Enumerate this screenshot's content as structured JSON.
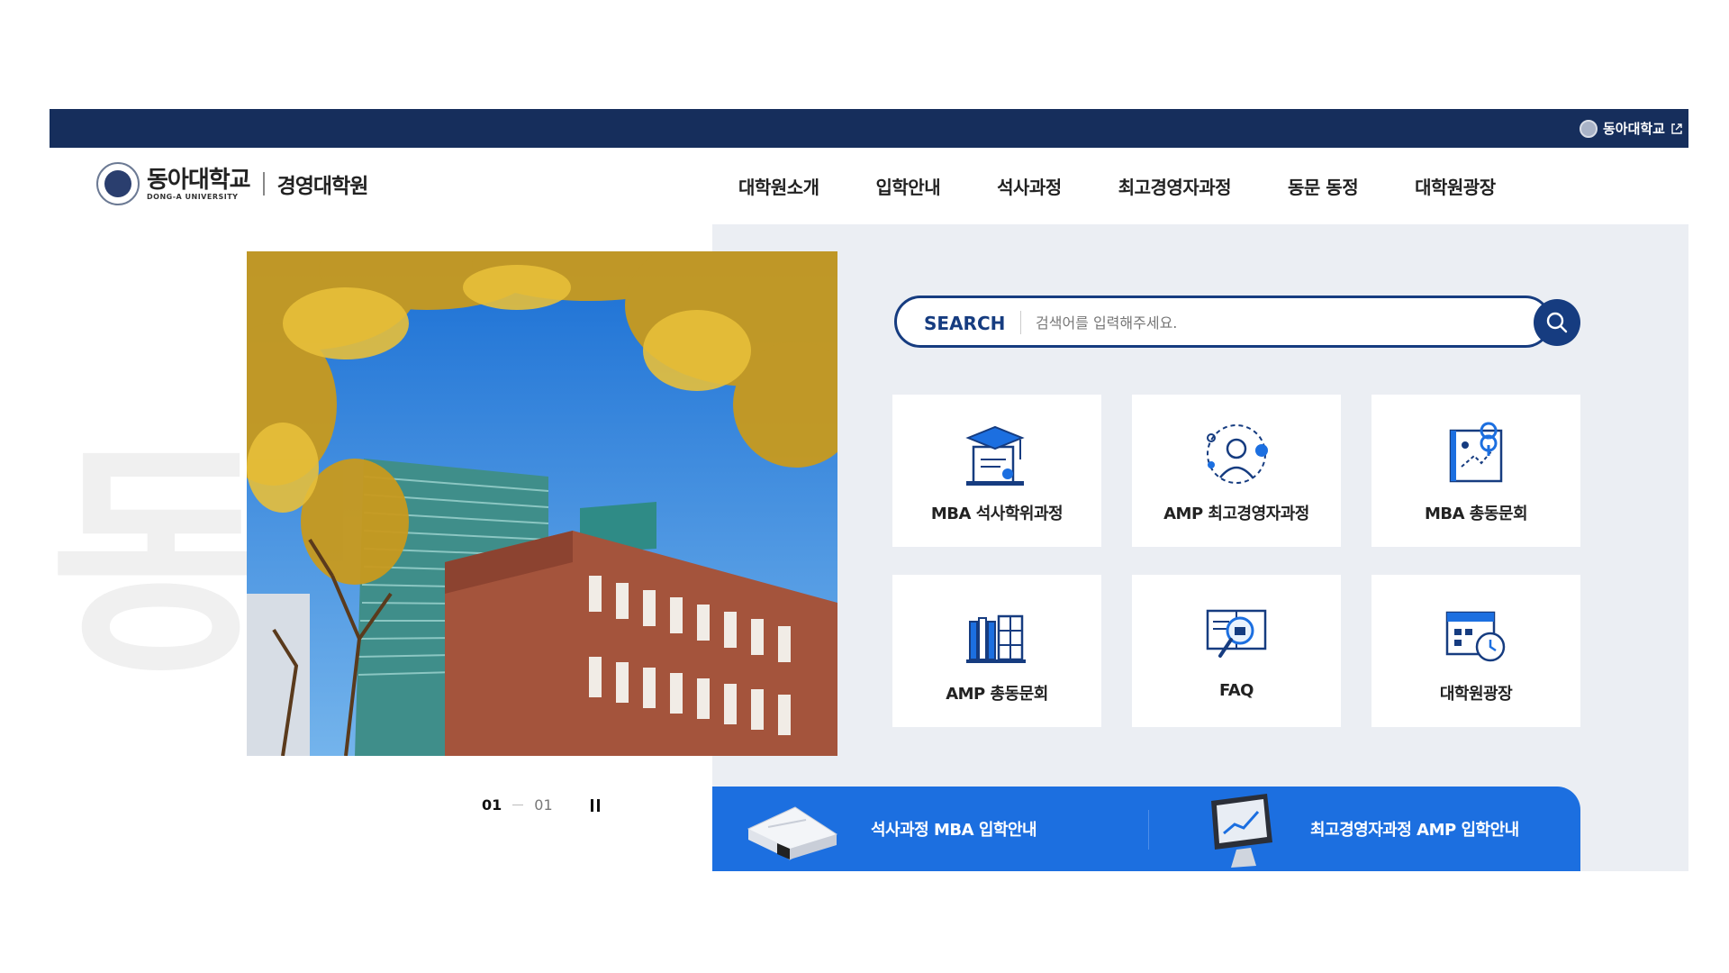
{
  "topbar": {
    "link_label": "동아대학교",
    "bg": "#162e5c"
  },
  "logo": {
    "name_ko": "동아대학교",
    "name_en": "DONG-A UNIVERSITY",
    "sub": "경영대학원"
  },
  "nav": {
    "items": [
      {
        "label": "대학원소개"
      },
      {
        "label": "입학안내"
      },
      {
        "label": "석사과정"
      },
      {
        "label": "최고경영자과정"
      },
      {
        "label": "동문 동정"
      },
      {
        "label": "대학원광장"
      }
    ]
  },
  "watermark": {
    "text": "동"
  },
  "slider": {
    "current": "01",
    "total": "01"
  },
  "search": {
    "label": "SEARCH",
    "placeholder": "검색어를 입력해주세요.",
    "accent": "#163c80"
  },
  "quick_links": [
    {
      "label": "MBA 석사학위과정",
      "icon": "graduation-diploma-icon"
    },
    {
      "label": "AMP 최고경영자과정",
      "icon": "executive-person-icon"
    },
    {
      "label": "MBA 총동문회",
      "icon": "map-pin-board-icon"
    },
    {
      "label": "AMP 총동문회",
      "icon": "books-shelf-icon"
    },
    {
      "label": "FAQ",
      "icon": "book-magnifier-icon"
    },
    {
      "label": "대학원광장",
      "icon": "calendar-clock-icon"
    }
  ],
  "banner": {
    "bg": "#1c6fe0",
    "items": [
      {
        "label": "석사과정 MBA 입학안내",
        "icon": "document-pack-icon"
      },
      {
        "label": "최고경영자과정 AMP 입학안내",
        "icon": "monitor-chart-icon"
      }
    ]
  }
}
